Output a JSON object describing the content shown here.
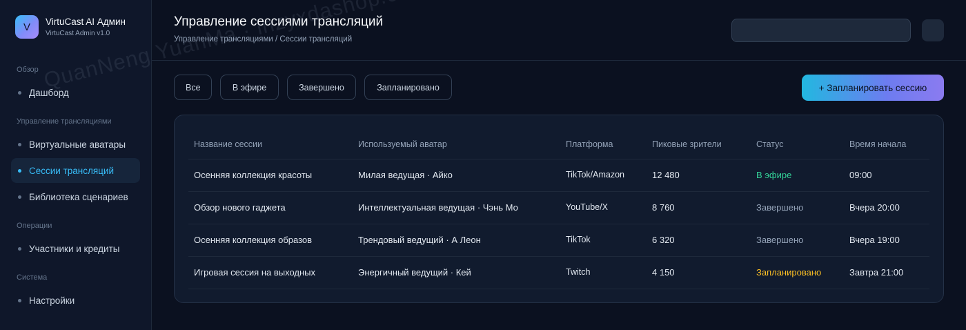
{
  "brand": {
    "logo_letter": "V",
    "name": "VirtuCast AI Админ",
    "subtitle": "VirtuCast Admin v1.0"
  },
  "sidebar": {
    "sections": [
      {
        "title": "Обзор",
        "items": [
          {
            "label": "Дашборд",
            "active": false
          }
        ]
      },
      {
        "title": "Управление трансляциями",
        "items": [
          {
            "label": "Виртуальные аватары",
            "active": false
          },
          {
            "label": "Сессии трансляций",
            "active": true
          },
          {
            "label": "Библиотека сценариев",
            "active": false
          }
        ]
      },
      {
        "title": "Операции",
        "items": [
          {
            "label": "Участники и кредиты",
            "active": false
          }
        ]
      },
      {
        "title": "Система",
        "items": [
          {
            "label": "Настройки",
            "active": false
          }
        ]
      }
    ]
  },
  "header": {
    "title": "Управление сессиями трансляций",
    "breadcrumb": "Управление трансляциями / Сессии трансляций",
    "search_value": ""
  },
  "filters": [
    "Все",
    "В эфире",
    "Завершено",
    "Запланировано"
  ],
  "actions": {
    "schedule_label": "+ Запланировать сессию"
  },
  "table": {
    "columns": [
      "Название сессии",
      "Используемый аватар",
      "Платформа",
      "Пиковые зрители",
      "Статус",
      "Время начала"
    ],
    "rows": [
      {
        "name": "Осенняя коллекция красоты",
        "avatar": "Милая ведущая · Айко",
        "platform": "TikTok/Amazon",
        "viewers": "12 480",
        "status": "В эфире",
        "status_kind": "live",
        "start": "09:00"
      },
      {
        "name": "Обзор нового гаджета",
        "avatar": "Интеллектуальная ведущая · Чэнь Мо",
        "platform": "YouTube/X",
        "viewers": "8 760",
        "status": "Завершено",
        "status_kind": "done",
        "start": "Вчера 20:00"
      },
      {
        "name": "Осенняя коллекция образов",
        "avatar": "Трендовый ведущий · А Леон",
        "platform": "TikTok",
        "viewers": "6 320",
        "status": "Завершено",
        "status_kind": "done",
        "start": "Вчера 19:00"
      },
      {
        "name": "Игровая сессия на выходных",
        "avatar": "Энергичный ведущий · Кей",
        "platform": "Twitch",
        "viewers": "4 150",
        "status": "Запланировано",
        "status_kind": "planned",
        "start": "Завтра 21:00"
      }
    ]
  },
  "watermark": "QuanNeng YuanMa · inzyxdashop.com",
  "colors": {
    "background": "#0b1120",
    "accent": "#38bdf8",
    "live": "#34d399",
    "planned": "#fbbf24",
    "done": "#94a3b8"
  }
}
